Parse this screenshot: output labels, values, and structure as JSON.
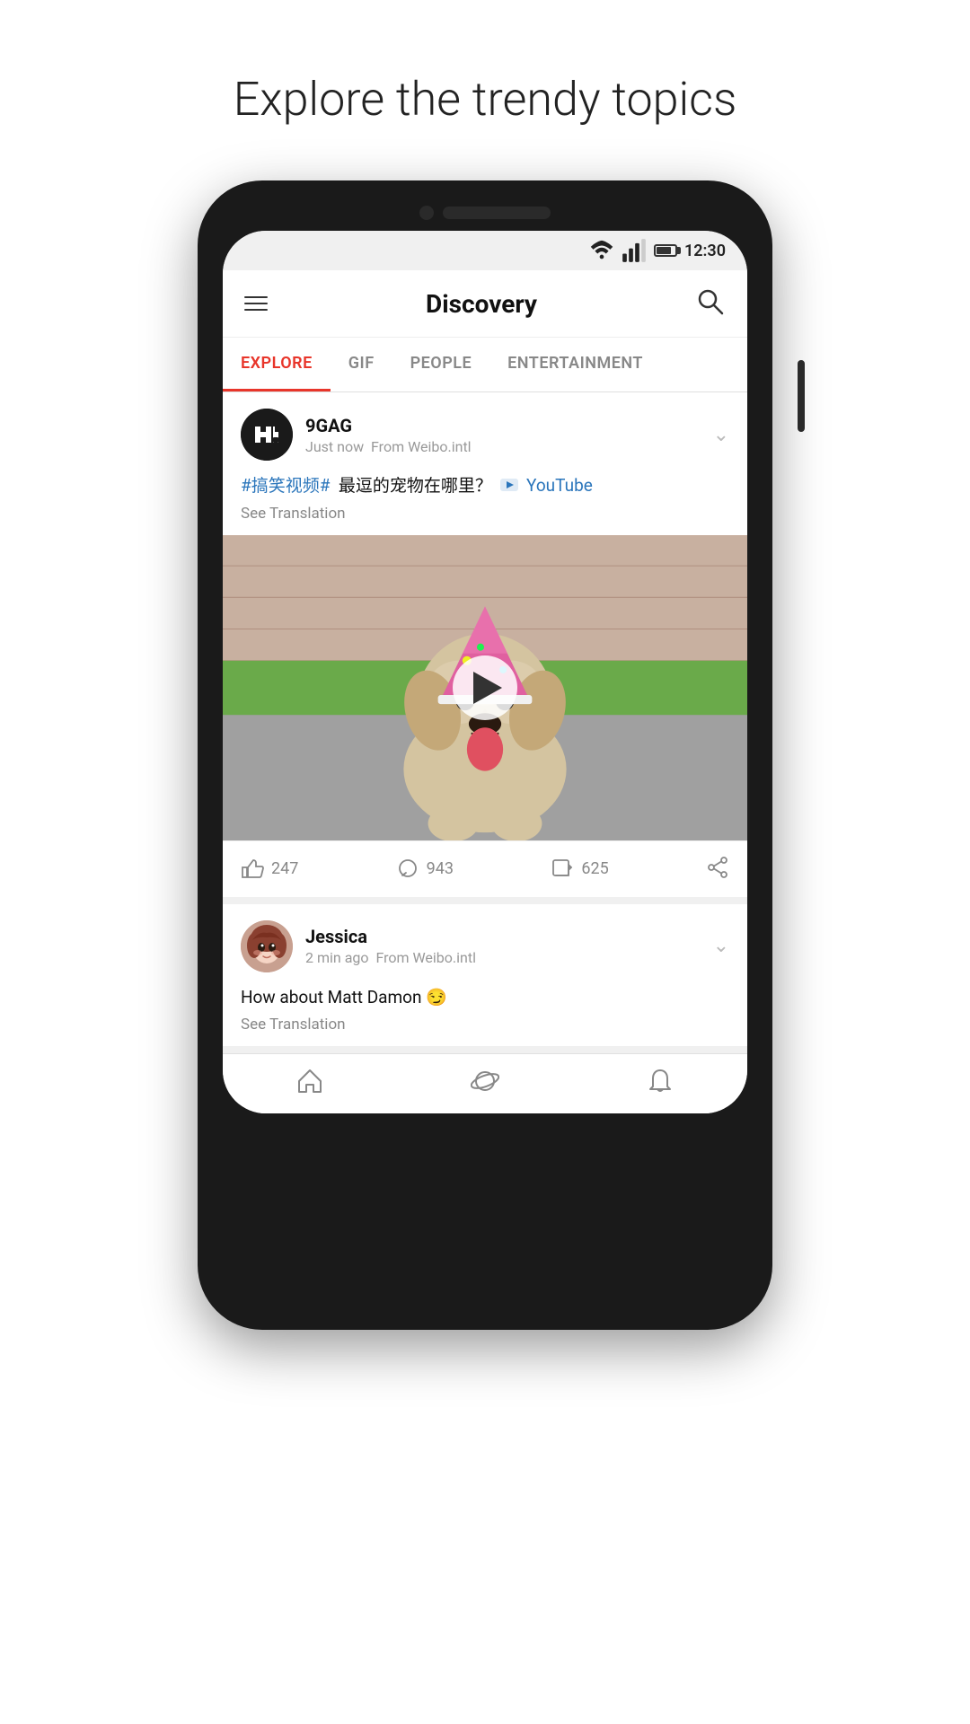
{
  "page": {
    "title": "Explore the trendy topics"
  },
  "status_bar": {
    "time": "12:30",
    "wifi": "wifi",
    "signal": "signal",
    "battery": "battery"
  },
  "header": {
    "title": "Discovery",
    "menu_label": "menu",
    "search_label": "search"
  },
  "tabs": [
    {
      "id": "explore",
      "label": "EXPLORE",
      "active": true
    },
    {
      "id": "gif",
      "label": "GIF",
      "active": false
    },
    {
      "id": "people",
      "label": "PEOPLE",
      "active": false
    },
    {
      "id": "entertainment",
      "label": "ENTERTAINMENT",
      "active": false
    }
  ],
  "posts": [
    {
      "id": "post1",
      "author": "9GAG",
      "time": "Just now",
      "source": "From Weibo.intl",
      "hashtag": "#搞笑视频#",
      "text_cn": "最逗的宠物在哪里？",
      "youtube_text": "YouTube",
      "see_translation": "See Translation",
      "has_video": true,
      "likes": "247",
      "comments": "943",
      "shares": "625"
    },
    {
      "id": "post2",
      "author": "Jessica",
      "time": "2 min ago",
      "source": "From Weibo.intl",
      "text": "How about Matt Damon 😏",
      "see_translation": "See Translation"
    }
  ],
  "bottom_nav": [
    {
      "id": "home",
      "label": "home"
    },
    {
      "id": "discover",
      "label": "discover"
    },
    {
      "id": "notifications",
      "label": "notifications"
    }
  ],
  "colors": {
    "accent_red": "#e8352a",
    "link_blue": "#2a75bb",
    "tab_active": "#e8352a",
    "bg_gray": "#f0f0f0"
  }
}
